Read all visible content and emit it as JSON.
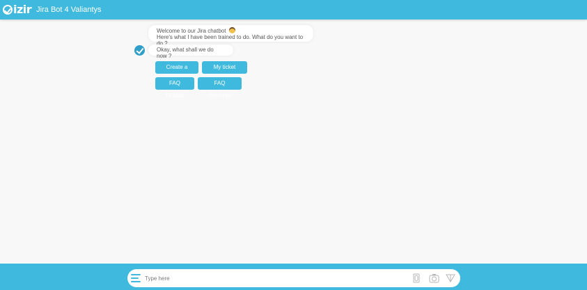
{
  "header": {
    "logo_text": "izir",
    "title": "Jira Bot 4 Valiantys",
    "background": "#3fb9dd"
  },
  "chat": {
    "messages": [
      {
        "line1": "Welcome to our Jira chatbot",
        "line2": "Here's what I have been trained to do. What do you want to do ?"
      },
      {
        "line1": "Okay, what shall we do now ?"
      }
    ],
    "quick_replies": [
      {
        "label": "Create a ticket"
      },
      {
        "label": "My ticket status"
      },
      {
        "label": "FAQ TEAMS"
      },
      {
        "label": "FAQ OneDrive"
      }
    ]
  },
  "composer": {
    "placeholder": "Type here",
    "icons": [
      "menu-icon",
      "paperclip-icon",
      "camera-icon",
      "send-icon"
    ]
  },
  "colors": {
    "accent": "#3fb9dd",
    "avatar": "#2f9fc7",
    "background": "#f8f8f8"
  }
}
